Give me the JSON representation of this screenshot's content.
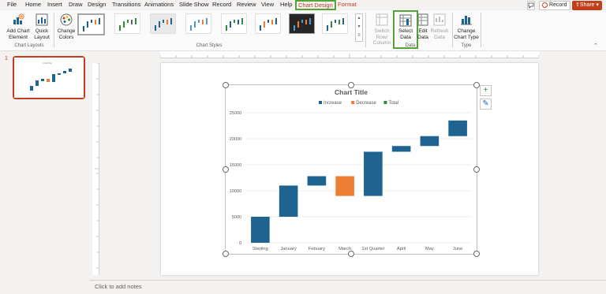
{
  "menu": {
    "items": [
      "File",
      "Home",
      "Insert",
      "Draw",
      "Design",
      "Transitions",
      "Animations",
      "Slide Show",
      "Record",
      "Review",
      "View",
      "Help",
      "Chart Design",
      "Format"
    ],
    "record_label": "Record",
    "share_label": "Share"
  },
  "ribbon": {
    "add_chart_element": "Add Chart Element",
    "quick_layout": "Quick Layout",
    "chart_layouts_group": "Chart Layouts",
    "change_colors": "Change Colors",
    "chart_styles_group": "Chart Styles",
    "switch_row_column": "Switch Row/ Column",
    "select_data": "Select Data",
    "edit_data": "Edit Data",
    "refresh_data": "Refresh Data",
    "data_group": "Data",
    "change_chart_type": "Change Chart Type",
    "type_group": "Type"
  },
  "slides": {
    "slide_number": "1"
  },
  "notes": {
    "placeholder": "Click to add notes"
  },
  "colors": {
    "increase": "#1f6391",
    "decrease": "#ed7d31",
    "total": "#2e8b3e",
    "accent": "#c43e1c",
    "highlight": "#52a535"
  },
  "chart_data": {
    "type": "bar",
    "subtype": "waterfall",
    "title": "Chart Title",
    "legend": [
      "Increase",
      "Decrease",
      "Total"
    ],
    "legend_position": "top",
    "categories": [
      "Starting",
      "January",
      "Febuary",
      "March",
      "1st Quarter",
      "April",
      "May",
      "June"
    ],
    "bars": [
      {
        "category": "Starting",
        "from": 0,
        "to": 5000,
        "kind": "Increase"
      },
      {
        "category": "January",
        "from": 5000,
        "to": 11000,
        "kind": "Increase"
      },
      {
        "category": "Febuary",
        "from": 11000,
        "to": 12800,
        "kind": "Increase"
      },
      {
        "category": "March",
        "from": 12800,
        "to": 9000,
        "kind": "Decrease"
      },
      {
        "category": "1st Quarter",
        "from": 9000,
        "to": 17500,
        "kind": "Increase"
      },
      {
        "category": "April",
        "from": 17500,
        "to": 18600,
        "kind": "Increase"
      },
      {
        "category": "May",
        "from": 18600,
        "to": 20500,
        "kind": "Increase"
      },
      {
        "category": "June",
        "from": 20500,
        "to": 23500,
        "kind": "Increase"
      }
    ],
    "ylim": [
      0,
      25000
    ],
    "yticks": [
      0,
      5000,
      10000,
      15000,
      20000,
      25000
    ],
    "grid": true
  }
}
